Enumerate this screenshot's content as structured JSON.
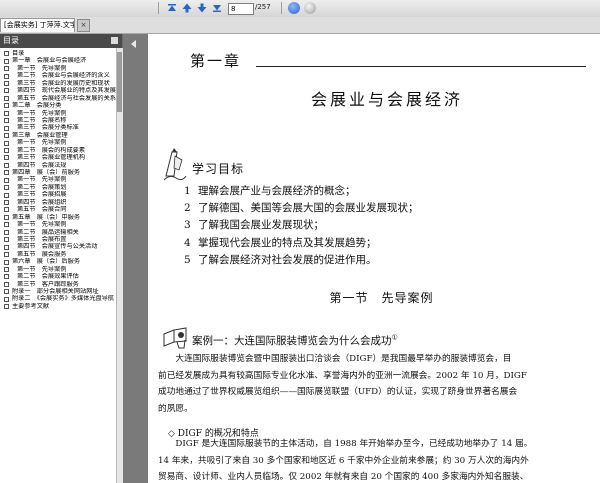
{
  "toolbar": {
    "page_current": "8",
    "page_total": "/257",
    "icons": [
      "first-page-icon",
      "prev-page-icon",
      "next-page-icon",
      "last-page-icon",
      "go-icon",
      "stop-icon"
    ]
  },
  "tab": {
    "title": "[会展实务] 丁萍萍.文字版",
    "close": "×"
  },
  "sidebar": {
    "title": "目录",
    "items": [
      {
        "indent": 0,
        "label": "目录"
      },
      {
        "indent": 0,
        "label": "第一章　会展业与会展经济"
      },
      {
        "indent": 1,
        "label": "第一节　先导案例"
      },
      {
        "indent": 1,
        "label": "第二节　会展业与会展经济的含义"
      },
      {
        "indent": 1,
        "label": "第三节　会展业的发展历史和现状"
      },
      {
        "indent": 1,
        "label": "第四节　现代会展业的特点及其发展"
      },
      {
        "indent": 1,
        "label": "第五节　会展经济与社会发展的关系"
      },
      {
        "indent": 0,
        "label": "第二章　会展分类"
      },
      {
        "indent": 1,
        "label": "第一节　先导案例"
      },
      {
        "indent": 1,
        "label": "第二节　会展名称"
      },
      {
        "indent": 1,
        "label": "第三节　会展分类标准"
      },
      {
        "indent": 0,
        "label": "第三章　会展业管理"
      },
      {
        "indent": 1,
        "label": "第一节　先导案例"
      },
      {
        "indent": 1,
        "label": "第二节　展会的构成要素"
      },
      {
        "indent": 1,
        "label": "第三节　会展业管理机构"
      },
      {
        "indent": 1,
        "label": "第四节　会展法规"
      },
      {
        "indent": 0,
        "label": "第四章　展（会）前服务"
      },
      {
        "indent": 1,
        "label": "第一节　先导案例"
      },
      {
        "indent": 1,
        "label": "第二节　会展策划"
      },
      {
        "indent": 1,
        "label": "第三节　会展招展"
      },
      {
        "indent": 1,
        "label": "第四节　会展组织"
      },
      {
        "indent": 1,
        "label": "第五节　会展合同"
      },
      {
        "indent": 0,
        "label": "第五章　展（会）中服务"
      },
      {
        "indent": 1,
        "label": "第一节　先导案例"
      },
      {
        "indent": 1,
        "label": "第二节　展品运输相关"
      },
      {
        "indent": 1,
        "label": "第三节　会展布置"
      },
      {
        "indent": 1,
        "label": "第四节　会展宣传与公关活动"
      },
      {
        "indent": 1,
        "label": "第五节　展会服务"
      },
      {
        "indent": 0,
        "label": "第六章　展（会）后服务"
      },
      {
        "indent": 1,
        "label": "第一节　先导案例"
      },
      {
        "indent": 1,
        "label": "第二节　会展效果评估"
      },
      {
        "indent": 1,
        "label": "第三节　客户跟踪服务"
      },
      {
        "indent": 0,
        "label": "附录一　部分会展相关网站网址"
      },
      {
        "indent": 0,
        "label": "附录二　《会展实务》多媒体光盘导航"
      },
      {
        "indent": 0,
        "label": "主要参考文献"
      }
    ]
  },
  "page": {
    "chapter_no": "第一章",
    "chapter_title": "会展业与会展经济",
    "goals_title": "学习目标",
    "goals": [
      {
        "num": "1",
        "text": "理解会展产业与会展经济的概念；"
      },
      {
        "num": "2",
        "text": "了解德国、美国等会展大国的会展业发展现状；"
      },
      {
        "num": "3",
        "text": "了解我国会展业发展现状；"
      },
      {
        "num": "4",
        "text": "掌握现代会展业的特点及其发展趋势；"
      },
      {
        "num": "5",
        "text": "了解会展经济对社会发展的促进作用。"
      }
    ],
    "section_title": "第一节　先导案例",
    "case_title": "案例一：大连国际服装博览会为什么会成功",
    "case_sup": "①",
    "para1": [
      "　　大连国际服装博览会暨中国服装出口洽谈会（DIGF）是我国最早举办的服装博览会，目",
      "前已经发展成为具有较高国际专业化水准、享誉海内外的亚洲一流展会。2002 年 10 月，DIGF",
      "成功地通过了世界权威展览组织——国际展览联盟（UFD）的认证，实现了跻身世界著名展会",
      "的夙愿。"
    ],
    "diamond": "◇ DIGF 的概况和特点",
    "para2": [
      "　　DIGF 是大连国际服装节的主体活动，自 1988 年开始举办至今，已经成功地举办了 14 届。",
      "14 年来，共吸引了来自 30 多个国家和地区近 6 千家中外企业前来参展；约 30 万人次的海内外",
      "贸易商、设计师、业内人员临场。仅 2002 年就有来自 20 个国家的 400 多家海内外知名服装、"
    ]
  },
  "colors": {
    "toolbar_blue": "#2a64c8",
    "sidebar_head": "#4a4a4a",
    "background": "#6e6e6e"
  }
}
